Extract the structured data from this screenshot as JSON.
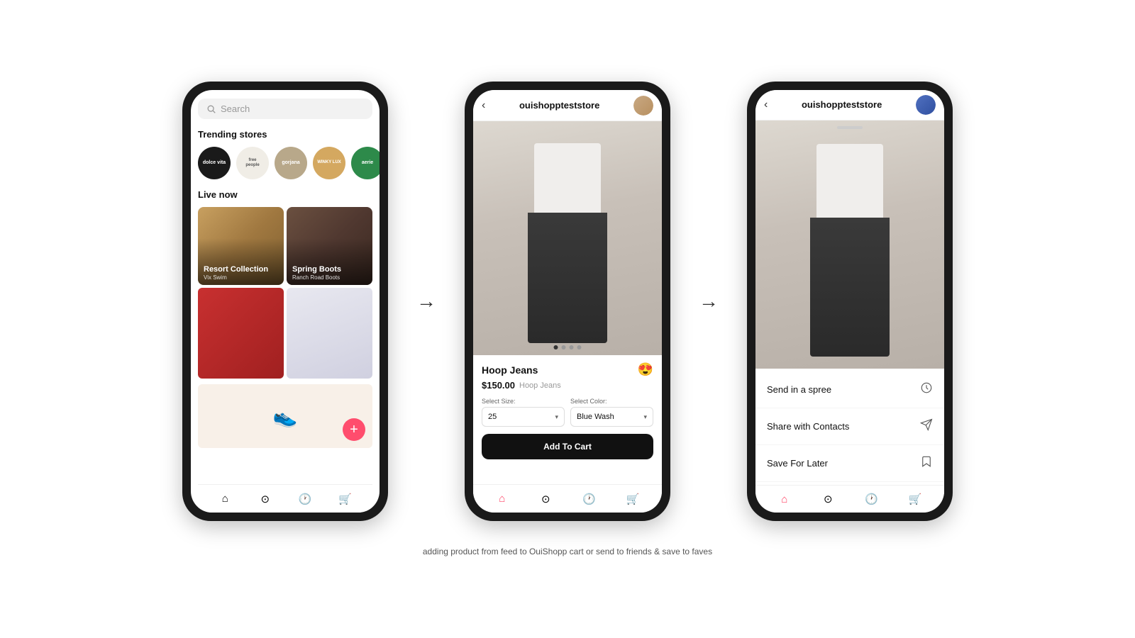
{
  "page": {
    "caption": "adding product from feed to OuiShopp cart or send to friends & save to faves"
  },
  "phone1": {
    "search_placeholder": "Search",
    "trending_title": "Trending stores",
    "live_now_title": "Live now",
    "stores": [
      {
        "name": "dolce vita",
        "bg": "#1a1a1a"
      },
      {
        "name": "free people",
        "bg": "#f0ede6",
        "text_color": "#555"
      },
      {
        "name": "gorjana",
        "bg": "#b8a47a"
      },
      {
        "name": "WINKY LUX",
        "bg": "#d4a060"
      },
      {
        "name": "aerie",
        "bg": "#2e8a45"
      }
    ],
    "live_cards": [
      {
        "title": "Resort Collection",
        "subtitle": "Vix Swim",
        "bg": "resort"
      },
      {
        "title": "Spring Boots",
        "subtitle": "Ranch Road Boots",
        "bg": "boots"
      }
    ]
  },
  "phone2": {
    "store_name": "ouishoppteststore",
    "product_name": "Hoop Jeans",
    "price": "$150.00",
    "price_label": "Hoop Jeans",
    "size_label": "Select Size:",
    "color_label": "Select Color:",
    "selected_size": "25",
    "selected_color": "Blue Wash",
    "add_to_cart": "Add To Cart",
    "dots": [
      true,
      false,
      false,
      false
    ]
  },
  "phone3": {
    "store_name": "ouishoppteststore",
    "options": [
      {
        "label": "Send in a spree",
        "icon": "clock-icon"
      },
      {
        "label": "Share with Contacts",
        "icon": "send-icon"
      },
      {
        "label": "Save For Later",
        "icon": "bookmark-icon"
      }
    ]
  },
  "arrows": {
    "symbol": "→"
  }
}
